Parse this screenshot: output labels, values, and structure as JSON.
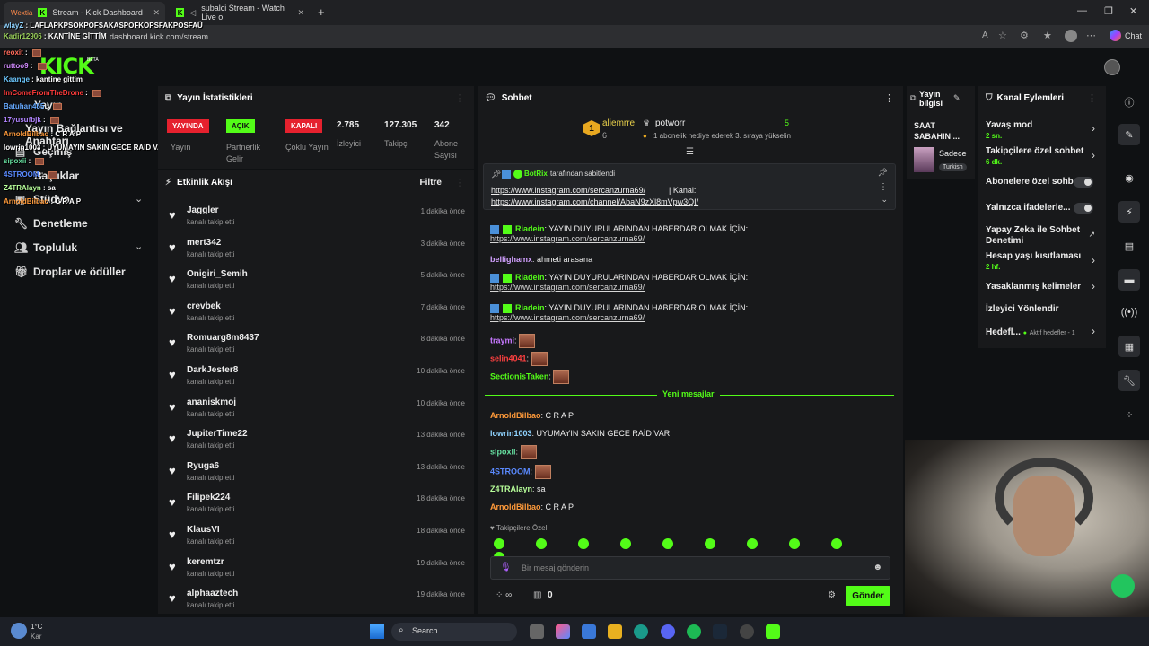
{
  "browser": {
    "tabs": [
      {
        "label": "Stream - Kick Dashboard",
        "prefix": "Wextia"
      },
      {
        "label": "subalci Stream - Watch Live o"
      }
    ],
    "address": "dashboard.kick.com/stream",
    "new_tab": "+",
    "chat_button": "Chat"
  },
  "header": {
    "logo": "KICK",
    "beta": "BETA"
  },
  "leftnav": {
    "items": [
      {
        "label": "Yayın"
      },
      {
        "label": "Yayın Bağlantısı ve Anahtarı"
      },
      {
        "label": "Geçmiş"
      },
      {
        "label": "Başlıklar"
      },
      {
        "label": "Stüdyo"
      },
      {
        "label": "Denetleme"
      },
      {
        "label": "Topluluk"
      },
      {
        "label": "Droplar ve ödüller"
      }
    ]
  },
  "overlay_chat": [
    {
      "user": "wlayZ",
      "text": "LAFLAPKPSOKPOFSAKASPOFKOPSFAKPOSFAÜ",
      "color": "#8fd3ff"
    },
    {
      "user": "Kadir12906",
      "text": "KANTİNE GİTTİM",
      "color": "#9ad05a"
    },
    {
      "user": "reoxit",
      "text": "",
      "color": "#ff6a5a",
      "emote": true
    },
    {
      "user": "ruttoo9",
      "text": "",
      "color": "#d28bff",
      "emote": true
    },
    {
      "user": "Kaange",
      "text": "kantine gittim",
      "color": "#6cc8ff"
    },
    {
      "user": "ImComeFromTheDrone",
      "text": "",
      "color": "#ff3a3a",
      "emote": true
    },
    {
      "user": "Batuhan465",
      "text": "",
      "color": "#66aaff",
      "emote": true
    },
    {
      "user": "17yusufbjk",
      "text": "",
      "color": "#b184ff",
      "emote": true
    },
    {
      "user": "ArnoldBilbao",
      "text": "C R A P",
      "color": "#ff9a3a"
    },
    {
      "user": "lowrin1003",
      "text": "UYUMAYIN SAKIN GECE RAİD VAR",
      "color": "#ffffff"
    },
    {
      "user": "sipoxii",
      "text": "",
      "color": "#66e0a0",
      "emote": true
    },
    {
      "user": "4STROOM",
      "text": "",
      "color": "#5a8aff",
      "emote": true
    },
    {
      "user": "Z4TRAlayn",
      "text": "sa",
      "color": "#b8ff9a"
    },
    {
      "user": "ArnoldBilbao",
      "text": "C R A P",
      "color": "#ff9a3a"
    }
  ],
  "stats": {
    "title": "Yayın İstatistikleri",
    "badges": [
      {
        "label": "YAYINDA",
        "caption": "Yayın",
        "bg": "#e5212e",
        "fg": "#ffffff"
      },
      {
        "label": "AÇIK",
        "caption": "Partnerlik Gelir",
        "bg": "#53fc18",
        "fg": "#111111"
      },
      {
        "label": "KAPALI",
        "caption": "Çoklu Yayın",
        "bg": "#e5212e",
        "fg": "#ffffff"
      }
    ],
    "numbers": [
      {
        "value": "2.785",
        "label": "İzleyici"
      },
      {
        "value": "127.305",
        "label": "Takipçi"
      },
      {
        "value": "342",
        "label": "Abone Sayısı"
      }
    ]
  },
  "activity": {
    "title": "Etkinlik Akışı",
    "filter": "Filtre",
    "items": [
      {
        "name": "Jaggler",
        "sub": "kanalı takip etti",
        "time": "1 dakika önce"
      },
      {
        "name": "mert342",
        "sub": "kanalı takip etti",
        "time": "3 dakika önce"
      },
      {
        "name": "Onigiri_Semih",
        "sub": "kanalı takip etti",
        "time": "5 dakika önce"
      },
      {
        "name": "crevbek",
        "sub": "kanalı takip etti",
        "time": "7 dakika önce"
      },
      {
        "name": "Romuarg8m8437",
        "sub": "kanalı takip etti",
        "time": "8 dakika önce"
      },
      {
        "name": "DarkJester8",
        "sub": "kanalı takip etti",
        "time": "10 dakika önce"
      },
      {
        "name": "ananiskmoj",
        "sub": "kanalı takip etti",
        "time": "10 dakika önce"
      },
      {
        "name": "JupiterTime22",
        "sub": "kanalı takip etti",
        "time": "13 dakika önce"
      },
      {
        "name": "Ryuga6",
        "sub": "kanalı takip etti",
        "time": "13 dakika önce"
      },
      {
        "name": "Filipek224",
        "sub": "kanalı takip etti",
        "time": "18 dakika önce"
      },
      {
        "name": "KlausVI",
        "sub": "kanalı takip etti",
        "time": "18 dakika önce"
      },
      {
        "name": "keremtzr",
        "sub": "kanalı takip etti",
        "time": "19 dakika önce"
      },
      {
        "name": "alphaaztech",
        "sub": "kanalı takip etti",
        "time": "19 dakika önce"
      }
    ]
  },
  "chat": {
    "title": "Sohbet",
    "leaders": [
      {
        "name": "aliemrre",
        "rank": "1",
        "count": "6"
      },
      {
        "name": "potworr",
        "count": "5",
        "note": "1 abonelik hediye ederek 3. sıraya yükselin"
      }
    ],
    "pinned": {
      "by": "BotRix",
      "by_suffix": "tarafından sabitlendi",
      "line1": "https://www.instagram.com/sercanzurna69/",
      "line1_tail": " | Kanal:",
      "line2": "https://www.instagram.com/channel/AbaN9zXl8mVpw3QI/"
    },
    "messages": [
      {
        "user": "Riadein",
        "color": "#53fc18",
        "text": "YAYIN DUYURULARINDAN HABERDAR OLMAK İÇİN:",
        "link": "https://www.instagram.com/sercanzurna69/",
        "bot": true
      },
      {
        "user": "bellighamx",
        "color": "#d2a0ff",
        "text": "ahmeti arasana"
      },
      {
        "user": "Riadein",
        "color": "#53fc18",
        "text": "YAYIN DUYURULARINDAN HABERDAR OLMAK İÇİN:",
        "link": "https://www.instagram.com/sercanzurna69/",
        "bot": true
      },
      {
        "user": "Riadein",
        "color": "#53fc18",
        "text": "YAYIN DUYURULARINDAN HABERDAR OLMAK İÇİN:",
        "link": "https://www.instagram.com/sercanzurna69/",
        "bot": true
      },
      {
        "user": "traymi",
        "color": "#c678ff",
        "text": "",
        "emote": true
      },
      {
        "user": "selin4041",
        "color": "#ff4040",
        "text": "",
        "emote": true
      },
      {
        "user": "SectionisTaken",
        "color": "#53fc18",
        "text": "",
        "emote": true
      }
    ],
    "new_divider": "Yeni mesajlar",
    "new_messages": [
      {
        "user": "ArnoldBilbao",
        "color": "#ff9a3a",
        "text": "C R A P"
      },
      {
        "user": "lowrin1003",
        "color": "#8fd3ff",
        "text": "UYUMAYIN SAKIN GECE RAİD VAR"
      },
      {
        "user": "sipoxii",
        "color": "#66e0a0",
        "text": "",
        "emote": true
      },
      {
        "user": "4STROOM",
        "color": "#5a8aff",
        "text": "",
        "emote": true
      },
      {
        "user": "Z4TRAlayn",
        "color": "#b8ff9a",
        "text": "sa"
      },
      {
        "user": "ArnoldBilbao",
        "color": "#ff9a3a",
        "text": "C R A P"
      }
    ],
    "followers_only": "Takipçilere Özel",
    "input_placeholder": "Bir mesaj gönderin",
    "count": "0",
    "send": "Gönder"
  },
  "info_panel": {
    "title": "Yayın bilgisi",
    "stream_title": "SAAT SABAHIN ...",
    "category": "Sadece",
    "lang": "Turkish"
  },
  "channel_actions": {
    "title": "Kanal Eylemleri",
    "items": [
      {
        "label": "Yavaş mod",
        "sub": "2 sn."
      },
      {
        "label": "Takipçilere özel sohbet",
        "sub": "6 dk."
      },
      {
        "label": "Abonelere özel sohbet"
      },
      {
        "label": "Yalnızca ifadelerle..."
      },
      {
        "label": "Yapay Zeka ile Sohbet Denetimi"
      },
      {
        "label": "Hesap yaşı kısıtlaması",
        "sub": "2 hf."
      },
      {
        "label": "Yasaklanmış kelimeler"
      },
      {
        "label": "İzleyici Yönlendir"
      },
      {
        "label": "Hedefl...",
        "sub": "Aktif hedefler - 1"
      }
    ]
  },
  "taskbar": {
    "weather_temp": "1°C",
    "weather_desc": "Kar",
    "search": "Search"
  },
  "colors": {
    "accent": "#53fc18",
    "danger": "#e5212e",
    "panel": "#18191b"
  }
}
